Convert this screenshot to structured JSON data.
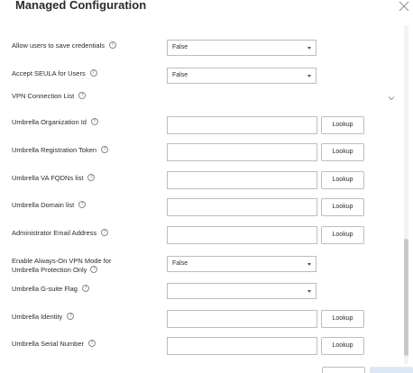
{
  "dialog": {
    "title": "Managed Configuration",
    "close_icon": "close-icon"
  },
  "fields": {
    "allow_save_credentials": {
      "label": "Allow users to save credentials",
      "value": "False"
    },
    "accept_seula": {
      "label": "Accept SEULA for Users",
      "value": "False"
    },
    "vpn_connection_list": {
      "label": "VPN Connection List"
    },
    "umbrella_org_id": {
      "label": "Umbrella Organization Id",
      "value": "",
      "button": "Lookup"
    },
    "umbrella_reg_token": {
      "label": "Umbrella Registration Token",
      "value": "",
      "button": "Lookup"
    },
    "umbrella_va_fqdns": {
      "label": "Umbrella VA FQDNs list",
      "value": "",
      "button": "Lookup"
    },
    "umbrella_domain_list": {
      "label": "Umbrella Domain list",
      "value": "",
      "button": "Lookup"
    },
    "admin_email": {
      "label": "Administrator Email Address",
      "value": "",
      "button": "Lookup"
    },
    "always_on_vpn": {
      "label_line1": "Enable Always-On VPN Mode for",
      "label_line2": "Umbrella Protection Only",
      "value": "False"
    },
    "gsuite_flag": {
      "label": "Umbrella G-suite Flag",
      "value": ""
    },
    "umbrella_identity": {
      "label": "Umbrella Identity",
      "value": "",
      "button": "Lookup"
    },
    "umbrella_serial": {
      "label": "Umbrella Serial Number",
      "value": "",
      "button": "Lookup"
    }
  },
  "help_glyph": "?",
  "icons": {
    "help": "help-circle-icon",
    "chevron": "chevron-down-icon",
    "caret": "dropdown-caret-icon"
  }
}
